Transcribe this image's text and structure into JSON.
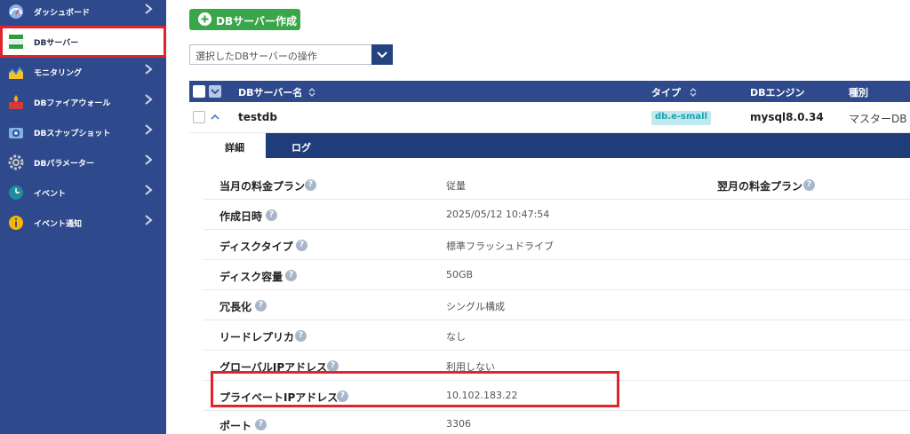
{
  "sidebar": {
    "items": [
      {
        "label": "ダッシュボード",
        "icon": "dashboard-icon"
      },
      {
        "label": "DBサーバー",
        "icon": "db-server-icon"
      },
      {
        "label": "モニタリング",
        "icon": "monitoring-icon"
      },
      {
        "label": "DBファイアウォール",
        "icon": "firewall-icon"
      },
      {
        "label": "DBスナップショット",
        "icon": "camera-icon"
      },
      {
        "label": "DBパラメーター",
        "icon": "gear-icon"
      },
      {
        "label": "イベント",
        "icon": "clock-icon"
      },
      {
        "label": "イベント通知",
        "icon": "info-icon"
      }
    ]
  },
  "toolbar": {
    "create_label": "DBサーバー作成",
    "action_select": "選択したDBサーバーの操作"
  },
  "table": {
    "headers": {
      "name": "DBサーバー名",
      "type": "タイプ",
      "engine": "DBエンジン",
      "kind": "種別"
    },
    "row": {
      "name": "testdb",
      "type": "db.e-small",
      "engine": "mysql8.0.34",
      "kind": "マスターDB"
    }
  },
  "tabs": [
    {
      "label": "詳細"
    },
    {
      "label": "ログ"
    }
  ],
  "details": [
    {
      "key": "当月の料金プラン",
      "value": "従量",
      "key2": "翌月の料金プラン"
    },
    {
      "key": "作成日時",
      "value": "2025/05/12 10:47:54"
    },
    {
      "key": "ディスクタイプ",
      "value": "標準フラッシュドライブ"
    },
    {
      "key": "ディスク容量",
      "value": "50GB"
    },
    {
      "key": "冗長化",
      "value": "シングル構成"
    },
    {
      "key": "リードレプリカ",
      "value": "なし"
    },
    {
      "key": "グローバルIPアドレス",
      "value": "利用しない"
    },
    {
      "key": "プライベートIPアドレス",
      "value": "10.102.183.22"
    },
    {
      "key": "ポート",
      "value": "3306"
    }
  ],
  "colors": {
    "sidebar_bg": "#2f4a8c",
    "create_button": "#3aa64a",
    "highlight_red": "#e0242b",
    "badge_bg": "#bfe9ee",
    "badge_text": "#1aa3b1"
  }
}
